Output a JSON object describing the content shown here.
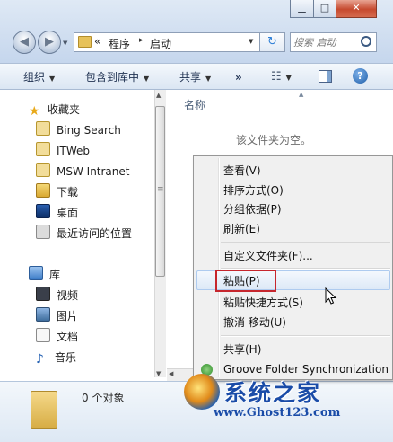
{
  "address": {
    "sep": "«",
    "crumbs": [
      "程序",
      "启动"
    ],
    "arrow": "▸"
  },
  "search": {
    "placeholder": "搜索 启动"
  },
  "toolbar": {
    "organize": "组织",
    "include_in_library": "包含到库中",
    "share": "共享",
    "more": "»"
  },
  "nav": {
    "favorites_header": "收藏夹",
    "favorites": [
      "Bing Search",
      "ITWeb",
      "MSW Intranet",
      "下载",
      "桌面",
      "最近访问的位置"
    ],
    "libraries_header": "库",
    "libraries": [
      "视频",
      "图片",
      "文档",
      "音乐"
    ]
  },
  "content": {
    "column_name": "名称",
    "empty_message": "该文件夹为空。"
  },
  "details": {
    "item_count": "0 个对象"
  },
  "context_menu": {
    "items": [
      "查看(V)",
      "排序方式(O)",
      "分组依据(P)",
      "刷新(E)",
      "自定义文件夹(F)...",
      "粘贴(P)",
      "粘贴快捷方式(S)",
      "撤消 移动(U)",
      "共享(H)",
      "Groove Folder Synchronization"
    ]
  },
  "watermark": {
    "title": "系统之家",
    "url": "www.Ghost123.com"
  },
  "colors": {
    "highlight_box": "#c6262d",
    "menu_hover": "#dde9f7",
    "chrome_blue": "#c9d9ee"
  }
}
